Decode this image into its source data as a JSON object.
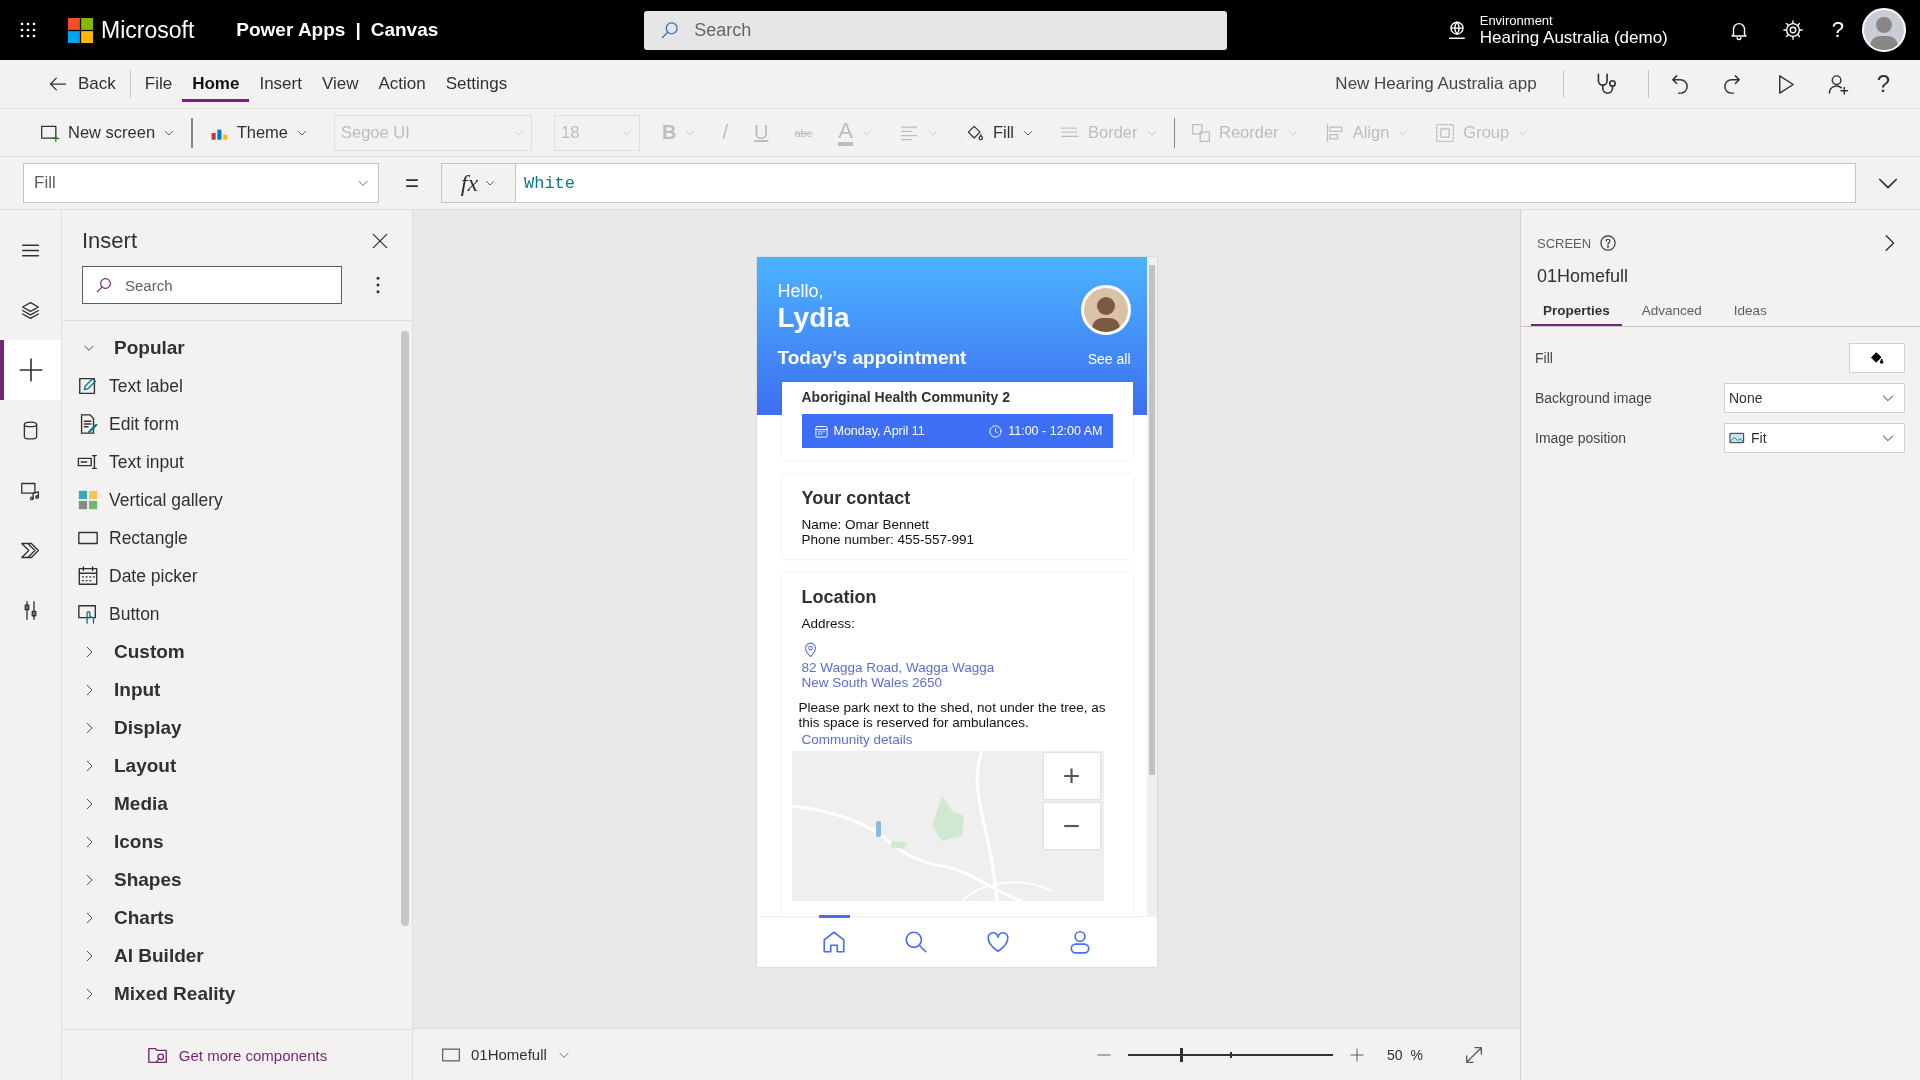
{
  "top_bar": {
    "brand": "Microsoft",
    "product": "Power Apps",
    "separator": "|",
    "app_type": "Canvas",
    "search": {
      "placeholder": "Search"
    },
    "environment": {
      "label": "Environment",
      "name": "Hearing Australia (demo)"
    },
    "help": "?"
  },
  "menu": {
    "back": "Back",
    "tabs": [
      {
        "label": "File",
        "selected": false
      },
      {
        "label": "Home",
        "selected": true
      },
      {
        "label": "Insert",
        "selected": false
      },
      {
        "label": "View",
        "selected": false
      },
      {
        "label": "Action",
        "selected": false
      },
      {
        "label": "Settings",
        "selected": false
      }
    ],
    "app_name": "New Hearing Australia app",
    "help": "?"
  },
  "toolbar": [
    {
      "kind": "new-screen",
      "label": "New screen",
      "dropdown": true,
      "disabled": false
    },
    {
      "kind": "theme",
      "label": "Theme",
      "dropdown": true,
      "disabled": false,
      "separator_before": true
    },
    {
      "kind": "font",
      "label": "Segoe UI",
      "dropdown": true,
      "disabled": true
    },
    {
      "kind": "size",
      "label": "18",
      "dropdown": true,
      "disabled": true
    },
    {
      "kind": "bold",
      "label": "B",
      "dropdown": true,
      "disabled": true
    },
    {
      "kind": "italic",
      "label": "/",
      "dropdown": false,
      "disabled": true
    },
    {
      "kind": "underline",
      "label": "U",
      "dropdown": false,
      "disabled": true
    },
    {
      "kind": "strike",
      "label": "abc",
      "dropdown": false,
      "disabled": true
    },
    {
      "kind": "font-color",
      "label": "A",
      "dropdown": true,
      "disabled": true
    },
    {
      "kind": "align",
      "dropdown": true,
      "disabled": true
    },
    {
      "kind": "fill",
      "label": "Fill",
      "dropdown": true,
      "disabled": false
    },
    {
      "kind": "border",
      "label": "Border",
      "dropdown": true,
      "disabled": true
    },
    {
      "kind": "reorder",
      "label": "Reorder",
      "dropdown": true,
      "disabled": true,
      "separator_before": true
    },
    {
      "kind": "align-objects",
      "label": "Align",
      "dropdown": true,
      "disabled": true
    },
    {
      "kind": "group",
      "label": "Group",
      "dropdown": true,
      "disabled": true
    }
  ],
  "formula_bar": {
    "property": "Fill",
    "equals": "=",
    "fx": "fx",
    "formula": "White"
  },
  "rail": [
    {
      "kind": "menu",
      "selected": false
    },
    {
      "kind": "layers",
      "selected": false
    },
    {
      "kind": "insert",
      "selected": true
    },
    {
      "kind": "data",
      "selected": false
    },
    {
      "kind": "media",
      "selected": false
    },
    {
      "kind": "automate",
      "selected": false
    },
    {
      "kind": "tools",
      "selected": false
    }
  ],
  "insert_panel": {
    "title": "Insert",
    "search": {
      "placeholder": "Search"
    },
    "groups": [
      {
        "label": "Popular",
        "expanded": true,
        "children": [
          {
            "label": "Text label",
            "kind": "text-label"
          },
          {
            "label": "Edit form",
            "kind": "edit-form"
          },
          {
            "label": "Text input",
            "kind": "text-input"
          },
          {
            "label": "Vertical gallery",
            "kind": "gallery"
          },
          {
            "label": "Rectangle",
            "kind": "rectangle"
          },
          {
            "label": "Date picker",
            "kind": "date-picker"
          },
          {
            "label": "Button",
            "kind": "button"
          }
        ]
      },
      {
        "label": "Custom",
        "expanded": false
      },
      {
        "label": "Input",
        "expanded": false
      },
      {
        "label": "Display",
        "expanded": false
      },
      {
        "label": "Layout",
        "expanded": false
      },
      {
        "label": "Media",
        "expanded": false
      },
      {
        "label": "Icons",
        "expanded": false
      },
      {
        "label": "Shapes",
        "expanded": false
      },
      {
        "label": "Charts",
        "expanded": false
      },
      {
        "label": "AI Builder",
        "expanded": false
      },
      {
        "label": "Mixed Reality",
        "expanded": false
      }
    ],
    "footer": "Get more components"
  },
  "app_preview": {
    "greeting": "Hello,",
    "user": "Lydia",
    "section_title": "Today’s appointment",
    "see_all": "See all",
    "appointment": {
      "title": "Aboriginal Health Community 2",
      "date": "Monday, April 11",
      "time": "11:00 - 12:00 AM"
    },
    "contact": {
      "title": "Your contact",
      "name": "Name: Omar Bennett",
      "phone": "Phone number: 455-557-991"
    },
    "location": {
      "title": "Location",
      "address_label": "Address:",
      "address": [
        "82 Wagga Road, Wagga Wagga",
        "New South Wales 2650"
      ],
      "note": "Please park next to the shed, not under the tree, as this space is reserved for ambulances.",
      "link": "Community details"
    },
    "map": {
      "kind": "picture",
      "zoom_in": "+",
      "zoom_out": "−"
    },
    "nav": [
      {
        "kind": "home",
        "selected": true
      },
      {
        "kind": "search",
        "selected": false
      },
      {
        "kind": "favorites",
        "selected": false
      },
      {
        "kind": "profile",
        "selected": false
      }
    ]
  },
  "canvas_bar": {
    "screen": "01Homefull",
    "zoom": {
      "level": 0.26,
      "value": "50",
      "unit": "%"
    }
  },
  "properties": {
    "type": "SCREEN",
    "name": "01Homefull",
    "tabs": [
      {
        "label": "Properties",
        "selected": true
      },
      {
        "label": "Advanced",
        "selected": false
      },
      {
        "label": "Ideas",
        "selected": false
      }
    ],
    "rows": [
      {
        "label": "Fill",
        "kind": "color"
      },
      {
        "label": "Background image",
        "kind": "dropdown",
        "value": "None"
      },
      {
        "label": "Image position",
        "kind": "image-dropdown",
        "value": "Fit"
      }
    ]
  }
}
